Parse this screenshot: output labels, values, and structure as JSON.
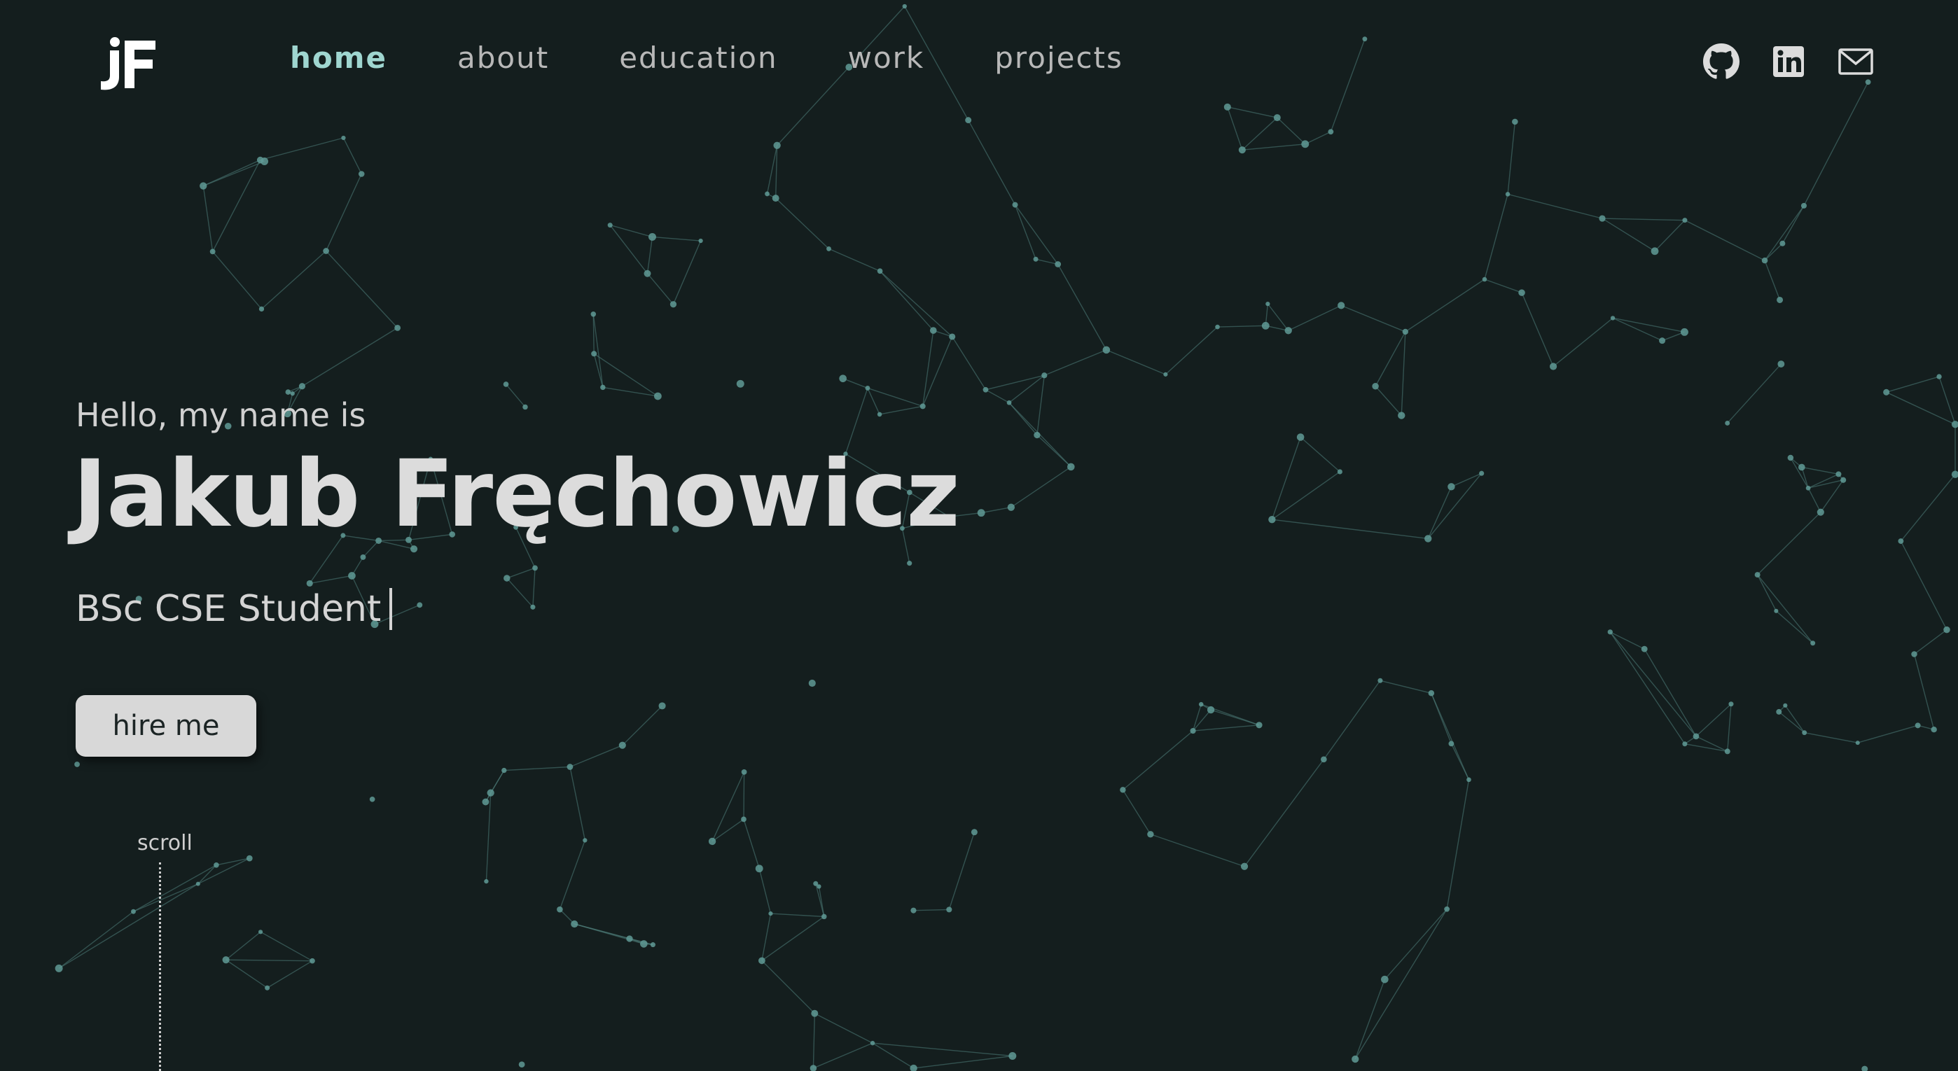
{
  "header": {
    "logo_text": "jF",
    "nav": [
      {
        "label": "home",
        "active": true
      },
      {
        "label": "about",
        "active": false
      },
      {
        "label": "education",
        "active": false
      },
      {
        "label": "work",
        "active": false
      },
      {
        "label": "projects",
        "active": false
      }
    ],
    "social": [
      {
        "icon": "github-icon"
      },
      {
        "icon": "linkedin-icon"
      },
      {
        "icon": "mail-icon"
      }
    ]
  },
  "hero": {
    "greeting": "Hello, my name is",
    "name": "Jakub Fręchowicz",
    "role": "BSc CSE Student",
    "cta": "hire me"
  },
  "scroll": {
    "label": "scroll"
  },
  "colors": {
    "background": "#141e1e",
    "accent": "#9fd6d0",
    "network": "#5f9a95",
    "text": "#dcdcdc",
    "button": "#d8d8d8"
  }
}
